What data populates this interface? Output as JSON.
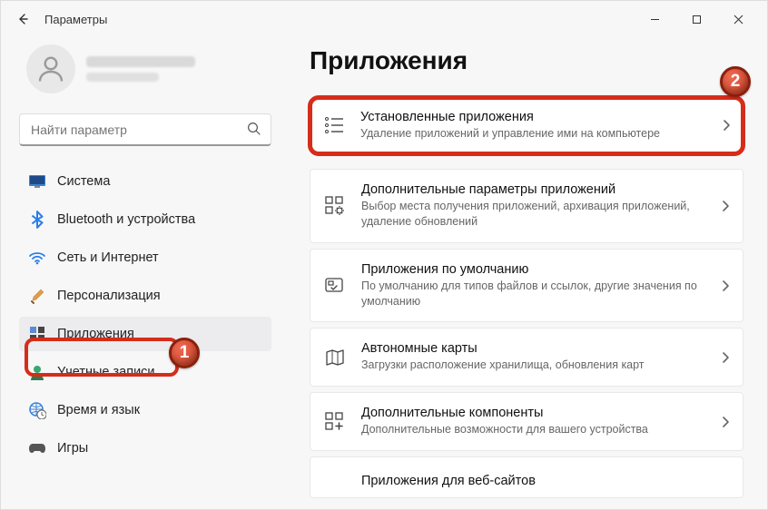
{
  "window": {
    "title": "Параметры"
  },
  "search": {
    "placeholder": "Найти параметр"
  },
  "nav": {
    "system": "Система",
    "bluetooth": "Bluetooth и устройства",
    "network": "Сеть и Интернет",
    "personalization": "Персонализация",
    "apps": "Приложения",
    "accounts": "Учетные записи",
    "time": "Время и язык",
    "gaming": "Игры"
  },
  "main": {
    "heading": "Приложения",
    "cards": {
      "installed": {
        "title": "Установленные приложения",
        "desc": "Удаление приложений и управление ими на компьютере"
      },
      "advanced": {
        "title": "Дополнительные параметры приложений",
        "desc": "Выбор места получения приложений, архивация приложений, удаление обновлений"
      },
      "default": {
        "title": "Приложения по умолчанию",
        "desc": "По умолчанию для типов файлов и ссылок, другие значения по умолчанию"
      },
      "maps": {
        "title": "Автономные карты",
        "desc": "Загрузки расположение хранилища, обновления карт"
      },
      "optional": {
        "title": "Дополнительные компоненты",
        "desc": "Дополнительные возможности для вашего устройства"
      },
      "websites": {
        "title": "Приложения для веб-сайтов"
      }
    }
  },
  "annotations": {
    "step1": "1",
    "step2": "2"
  }
}
